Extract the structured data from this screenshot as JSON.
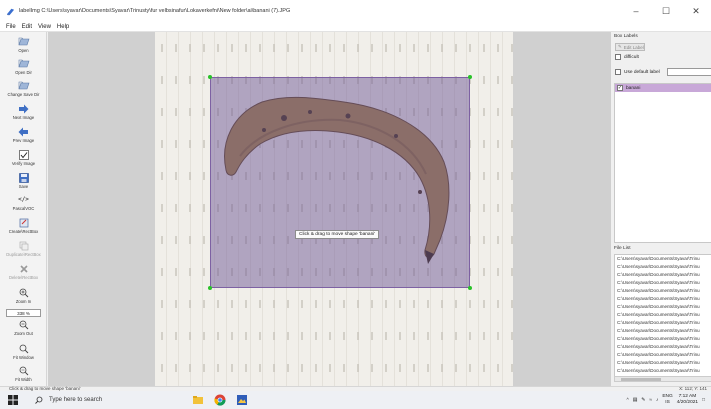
{
  "window": {
    "title": "labelImg C:\\Users\\syavar\\Documents\\Syavar\\Trinusty\\fur velbsinafur\\Lokaverkefni\\New folder\\ai\\banani (7).JPG",
    "controls": [
      "minimize-icon",
      "maximize-icon",
      "close-icon"
    ]
  },
  "menu": [
    "File",
    "Edit",
    "View",
    "Help"
  ],
  "toolbar": {
    "open": "Open",
    "open_dir": "Open Dir",
    "change_save_dir": "Change Save Dir",
    "next_image": "Next Image",
    "prev_image": "Prev Image",
    "verify_image": "Verify Image",
    "save": "Save",
    "format": "PascalVOC",
    "create_rectbox": "Create\\nRectBox",
    "duplicate_rectbox": "Duplicate\\nRectBox",
    "delete_rectbox": "Delete\\nRectBox",
    "zoom_in": "Zoom In",
    "zoom_value": "338 %",
    "zoom_out": "Zoom Out",
    "fit_window": "Fit Window",
    "fit_width": "Fit Width"
  },
  "canvas": {
    "tooltip": "Click & drag to move shape 'banani'",
    "shape_label": "banani",
    "bbox_color": "#7a5a9a",
    "handle_color": "#29c229"
  },
  "right_panel": {
    "box_labels_title": "Box Labels",
    "edit_label": "Edit Label",
    "difficult": "difficult",
    "use_default_label": "Use default label",
    "labels": [
      {
        "name": "banani",
        "checked": true
      }
    ],
    "file_list_title": "File List",
    "files": [
      "C:\\Users\\syavar\\Documents\\Syavar\\Trinu",
      "C:\\Users\\syavar\\Documents\\Syavar\\Trinu",
      "C:\\Users\\syavar\\Documents\\Syavar\\Trinu",
      "C:\\Users\\syavar\\Documents\\Syavar\\Trinu",
      "C:\\Users\\syavar\\Documents\\Syavar\\Trinu",
      "C:\\Users\\syavar\\Documents\\Syavar\\Trinu",
      "C:\\Users\\syavar\\Documents\\Syavar\\Trinu",
      "C:\\Users\\syavar\\Documents\\Syavar\\Trinu",
      "C:\\Users\\syavar\\Documents\\Syavar\\Trinu",
      "C:\\Users\\syavar\\Documents\\Syavar\\Trinu",
      "C:\\Users\\syavar\\Documents\\Syavar\\Trinu",
      "C:\\Users\\syavar\\Documents\\Syavar\\Trinu",
      "C:\\Users\\syavar\\Documents\\Syavar\\Trinu",
      "C:\\Users\\syavar\\Documents\\Syavar\\Trinu",
      "C:\\Users\\syavar\\Documents\\Syavar\\Trinu"
    ]
  },
  "status": {
    "message": "Click & drag to move shape 'banani'",
    "coords": "X: 112; Y: 141"
  },
  "taskbar": {
    "search_placeholder": "Type here to search",
    "language": "ENG",
    "region": "IS",
    "time": "7:12 AM",
    "date": "4/20/2021"
  }
}
